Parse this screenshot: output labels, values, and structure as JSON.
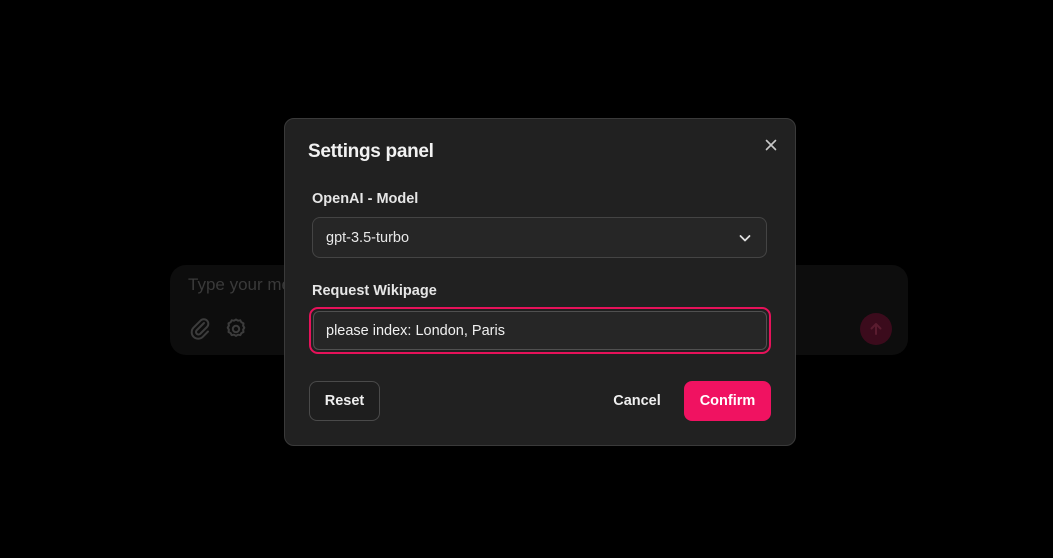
{
  "composer": {
    "placeholder": "Type your me",
    "attach_icon": "paperclip-icon",
    "settings_icon": "gear-icon",
    "send_icon": "arrow-up-icon"
  },
  "modal": {
    "title": "Settings panel",
    "close_icon": "close-icon",
    "model_label": "OpenAI - Model",
    "model_value": "gpt-3.5-turbo",
    "wiki_label": "Request Wikipage",
    "wiki_value": "please index: London, Paris",
    "reset_label": "Reset",
    "cancel_label": "Cancel",
    "confirm_label": "Confirm"
  },
  "colors": {
    "accent": "#f01261",
    "background": "#000000",
    "modal_bg": "#212121"
  }
}
